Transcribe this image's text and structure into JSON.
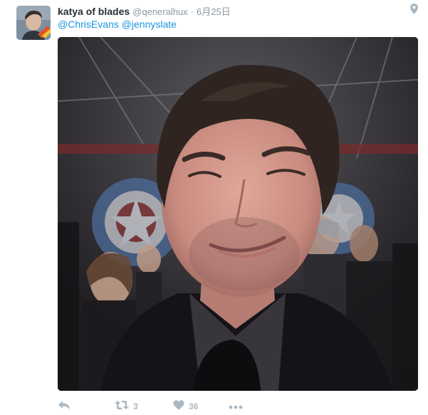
{
  "author": {
    "display_name": "katya of blades",
    "handle": "@qeneralhux",
    "separator": "·",
    "timestamp": "6月25日"
  },
  "tweet": {
    "mentions": [
      "@ChrisEvans",
      "@jennyslate"
    ],
    "mention_1": "@ChrisEvans",
    "mention_2": "@jennyslate"
  },
  "actions": {
    "reply_icon": "reply-icon",
    "retweet_icon": "retweet-icon",
    "retweet_count": "3",
    "like_icon": "heart-icon",
    "like_count": "36",
    "more_icon": "more-icon"
  },
  "header_icons": {
    "location_icon": "location-pin-icon"
  },
  "colors": {
    "link": "#1b95e0",
    "secondary_text": "#8899a6",
    "action_icon": "#aab8c2",
    "primary_text": "#292f33"
  }
}
